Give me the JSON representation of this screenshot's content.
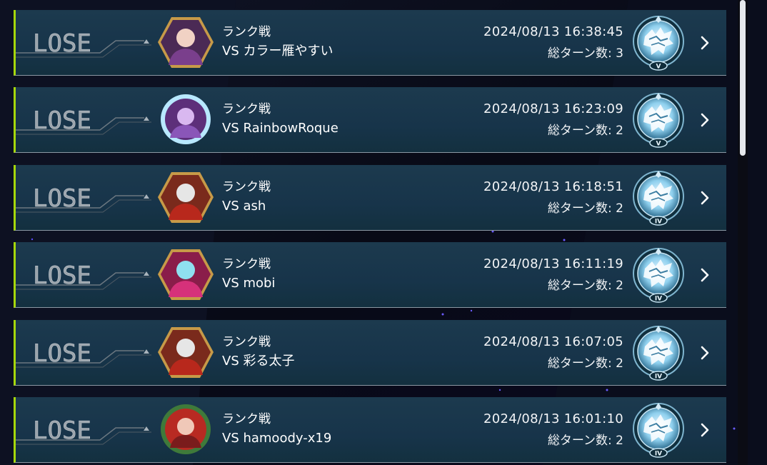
{
  "colors": {
    "row_accent": "#a6d80b",
    "row_bg": "#17344a",
    "lose_text": "#9aa3ab",
    "text": "#ffffff"
  },
  "matches": [
    {
      "result": "LOSE",
      "mode": "ランク戦",
      "opponent": "VS カラー雁やすい",
      "datetime": "2024/08/13 16:38:45",
      "turns": "総ターン数: 3",
      "rank": "V",
      "avatar": "hexagon-avatar-purple-character"
    },
    {
      "result": "LOSE",
      "mode": "ランク戦",
      "opponent": "VS RainbowRoque",
      "datetime": "2024/08/13 16:23:09",
      "turns": "総ターン数: 2",
      "rank": "V",
      "avatar": "round-avatar-glowing-purple-character"
    },
    {
      "result": "LOSE",
      "mode": "ランク戦",
      "opponent": "VS ash",
      "datetime": "2024/08/13 16:18:51",
      "turns": "総ターン数: 2",
      "rank": "IV",
      "avatar": "hexagon-avatar-red-cap-duelist"
    },
    {
      "result": "LOSE",
      "mode": "ランク戦",
      "opponent": "VS mobi",
      "datetime": "2024/08/13 16:11:19",
      "turns": "総ターン数: 2",
      "rank": "IV",
      "avatar": "hexagon-avatar-pink-dragon"
    },
    {
      "result": "LOSE",
      "mode": "ランク戦",
      "opponent": "VS 彩る太子",
      "datetime": "2024/08/13 16:07:05",
      "turns": "総ターン数: 2",
      "rank": "IV",
      "avatar": "hexagon-avatar-red-cap-duelist"
    },
    {
      "result": "LOSE",
      "mode": "ランク戦",
      "opponent": "VS hamoody-x19",
      "datetime": "2024/08/13 16:01:10",
      "turns": "総ターン数: 2",
      "rank": "IV",
      "avatar": "round-avatar-red-hair-wreath"
    }
  ]
}
